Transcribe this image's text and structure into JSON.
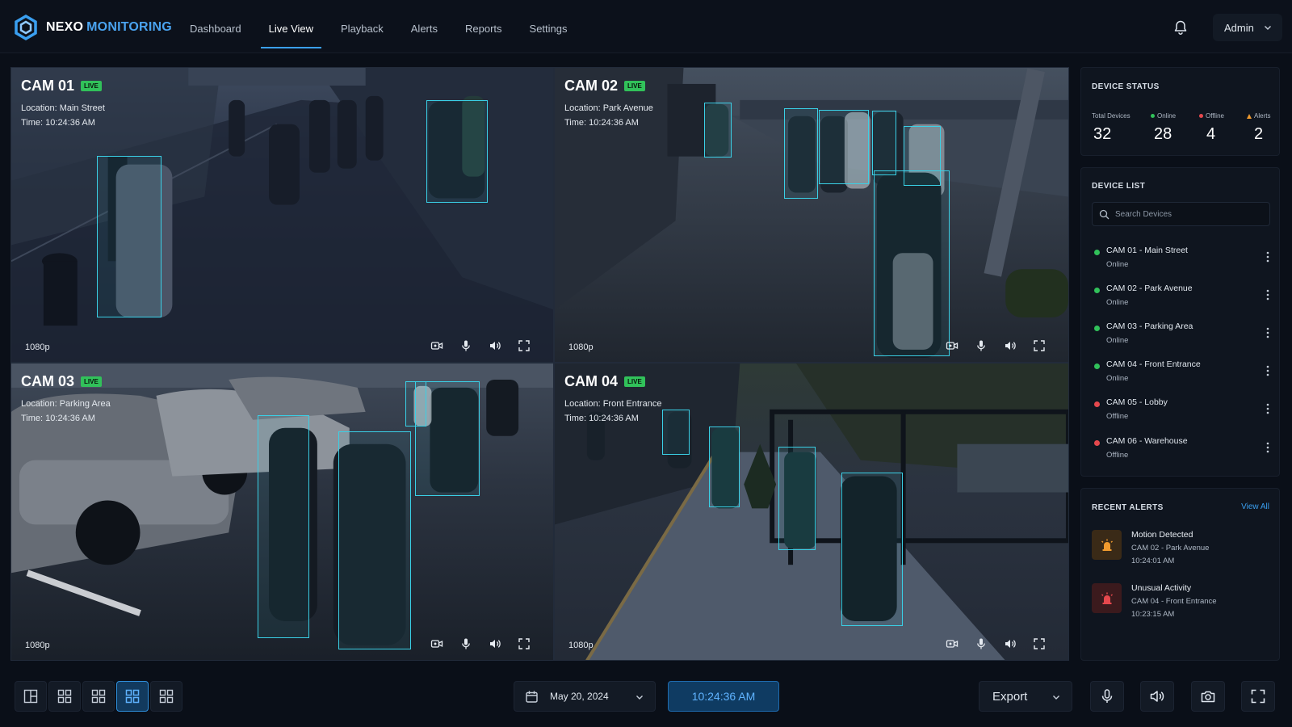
{
  "app": {
    "brand_primary": "NEXO",
    "brand_secondary": "MONITORING"
  },
  "nav": [
    {
      "label": "Dashboard"
    },
    {
      "label": "Live View",
      "active": true
    },
    {
      "label": "Playback"
    },
    {
      "label": "Alerts"
    },
    {
      "label": "Reports"
    },
    {
      "label": "Settings"
    }
  ],
  "user": {
    "name": "Admin"
  },
  "cameras": [
    {
      "name": "CAM 01",
      "badge": "LIVE",
      "location": "Location: Main Street",
      "time": "Time: 10:24:36 AM",
      "resolution": "1080p"
    },
    {
      "name": "CAM 02",
      "badge": "LIVE",
      "location": "Location: Park Avenue",
      "time": "Time: 10:24:36 AM",
      "resolution": "1080p"
    },
    {
      "name": "CAM 03",
      "badge": "LIVE",
      "location": "Location: Parking Area",
      "time": "Time: 10:24:36 AM",
      "resolution": "1080p"
    },
    {
      "name": "CAM 04",
      "badge": "LIVE",
      "location": "Location: Front Entrance",
      "time": "Time: 10:24:36 AM",
      "resolution": "1080p"
    }
  ],
  "device_status": {
    "title": "DEVICE STATUS",
    "total_label": "Total Devices",
    "total": "32",
    "online_label": "Online",
    "online": "28",
    "offline_label": "Offline",
    "offline": "4",
    "alerts_label": "Alerts",
    "alerts": "2"
  },
  "device_list": {
    "title": "DEVICE LIST",
    "search_placeholder": "Search Devices",
    "items": [
      {
        "name": "CAM 01 - Main Street",
        "status": "Online"
      },
      {
        "name": "CAM 02 - Park Avenue",
        "status": "Online"
      },
      {
        "name": "CAM 03 - Parking Area",
        "status": "Online"
      },
      {
        "name": "CAM 04 - Front Entrance",
        "status": "Online"
      },
      {
        "name": "CAM 05 - Lobby",
        "status": "Offline"
      },
      {
        "name": "CAM 06 - Warehouse",
        "status": "Offline"
      }
    ]
  },
  "recent_alerts": {
    "title": "RECENT ALERTS",
    "view_all": "View All",
    "items": [
      {
        "title": "Motion Detected",
        "source": "CAM 02 - Park Avenue",
        "time": "10:24:01 AM"
      },
      {
        "title": "Unusual Activity",
        "source": "CAM 04 - Front Entrance",
        "time": "10:23:15 AM"
      }
    ]
  },
  "bottom": {
    "date": "May 20, 2024",
    "time": "10:24:36 AM",
    "export": "Export"
  },
  "colors": {
    "accent": "#3a9ff0",
    "online": "#31c15a",
    "offline": "#e5484d",
    "alert": "#f09a2e",
    "detection": "#3ad0e6"
  }
}
